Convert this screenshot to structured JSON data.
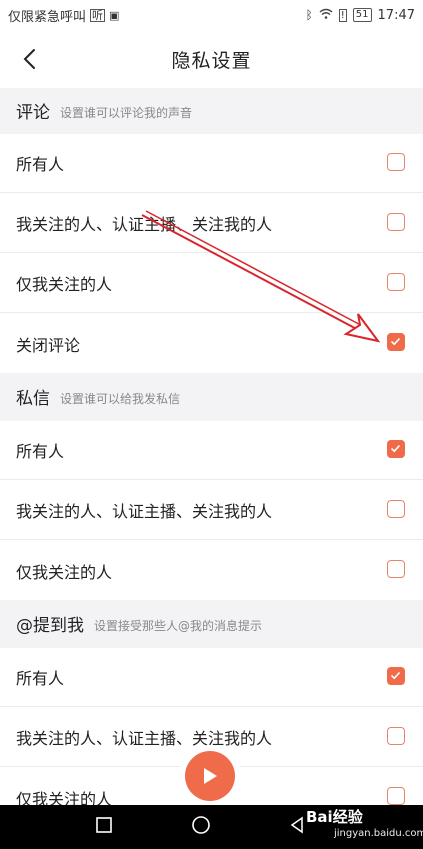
{
  "status_bar": {
    "left_text": "仅限紧急呼叫",
    "time": "17:47",
    "battery": "51"
  },
  "header": {
    "title": "隐私设置"
  },
  "sections": [
    {
      "title": "评论",
      "subtitle": "设置谁可以评论我的声音",
      "options": [
        {
          "label": "所有人",
          "checked": false
        },
        {
          "label": "我关注的人、认证主播、关注我的人",
          "checked": false
        },
        {
          "label": "仅我关注的人",
          "checked": false
        },
        {
          "label": "关闭评论",
          "checked": true
        }
      ]
    },
    {
      "title": "私信",
      "subtitle": "设置谁可以给我发私信",
      "options": [
        {
          "label": "所有人",
          "checked": true
        },
        {
          "label": "我关注的人、认证主播、关注我的人",
          "checked": false
        },
        {
          "label": "仅我关注的人",
          "checked": false
        }
      ]
    },
    {
      "title": "@提到我",
      "subtitle": "设置接受那些人@我的消息提示",
      "options": [
        {
          "label": "所有人",
          "checked": true
        },
        {
          "label": "我关注的人、认证主播、关注我的人",
          "checked": false
        },
        {
          "label": "仅我关注的人",
          "checked": false
        }
      ]
    }
  ],
  "watermark": {
    "brand": "Bai经验",
    "url": "jingyan.baidu.com"
  },
  "colors": {
    "accent": "#f06b4a",
    "section_bg": "#f3f3f5",
    "annotation_arrow": "#d9252b"
  }
}
